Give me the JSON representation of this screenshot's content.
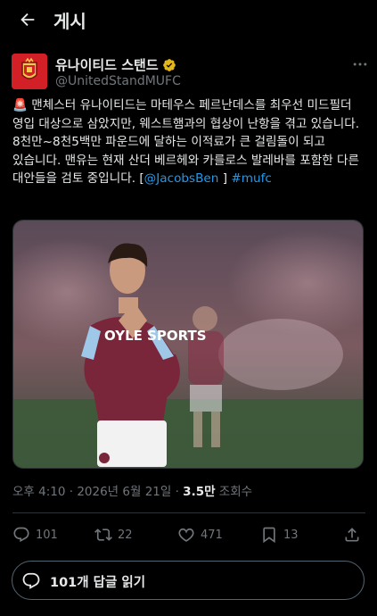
{
  "header": {
    "title": "게시",
    "back_icon": "arrow-left-icon"
  },
  "author": {
    "display_name": "유나이티드 스탠드",
    "handle": "@UnitedStandMUFC",
    "verified_color": "#e2b719",
    "avatar_color": "#d31f26"
  },
  "tweet": {
    "text_main": "🚨 맨체스터 유나이티드는 마테우스 페르난데스를 최우선 미드필더 영입 대상으로 삼았지만, 웨스트햄과의 협상이 난항을 겪고 있습니다. 8천만~8천5백만 파운드에 달하는 이적료가 큰 걸림돌이 되고 있습니다. 맨유는 현재 산더 베르헤와 카를로스 발레바를 포함한 다른 대안들을 검토 중입니다. [",
    "mention": "@JacobsBen",
    "text_bracket": " ] ",
    "hashtag": "#mufc"
  },
  "media": {
    "sponsor_text": "OYLE SPORTS",
    "kit_color": "#7a263a"
  },
  "meta": {
    "time": "오후 4:10 · 2026년 6월 21일 · ",
    "views_count": "3.5만",
    "views_label": " 조회수"
  },
  "actions": {
    "replies": "101",
    "retweets": "22",
    "likes": "471",
    "bookmarks": "13"
  },
  "reply_button": {
    "label": "101개 답글 읽기"
  },
  "colors": {
    "accent": "#1d9bf0",
    "muted": "#71767b",
    "text": "#e7e9ea",
    "background": "#000000"
  }
}
